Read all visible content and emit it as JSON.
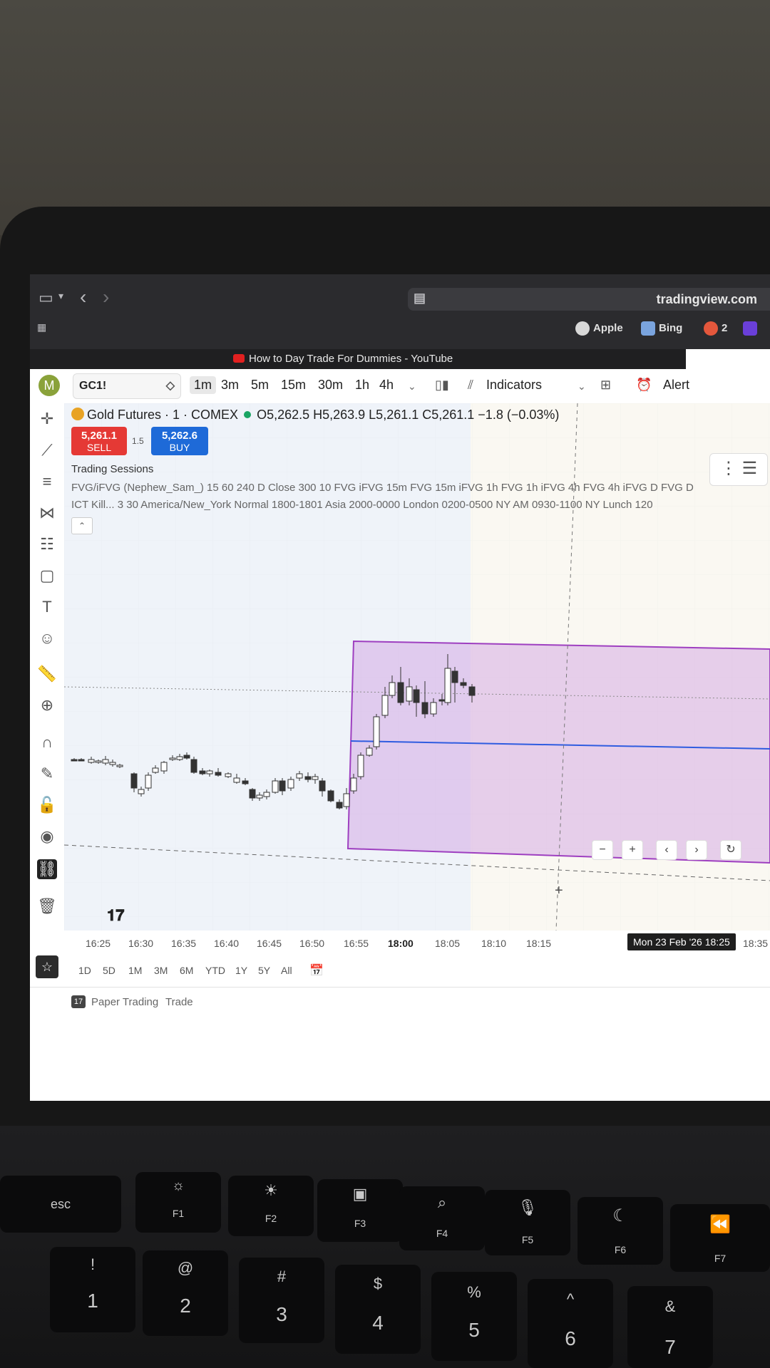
{
  "browser": {
    "url": "tradingview.com",
    "favorites": [
      {
        "label": "Apple",
        "icon": "apple-icon"
      },
      {
        "label": "Bing",
        "icon": "bing-icon"
      },
      {
        "label": "2",
        "icon": "google-icon"
      }
    ],
    "tab_title": "How to Day Trade For Dummies - YouTube"
  },
  "toolbar": {
    "avatar_letter": "M",
    "symbol": "GC1!",
    "timeframes": [
      "1m",
      "3m",
      "5m",
      "15m",
      "30m",
      "1h",
      "4h"
    ],
    "active_timeframe": "1m",
    "indicators_label": "Indicators",
    "alert_label": "Alert"
  },
  "legend": {
    "instrument": "Gold Futures · 1 · COMEX",
    "ohlc": "O5,262.5 H5,263.9 L5,261.1 C5,261.1 −1.8 (−0.03%)",
    "sell_price": "5,261.1",
    "sell_label": "SELL",
    "spread": "1.5",
    "buy_price": "5,262.6",
    "buy_label": "BUY",
    "indicator1": "Trading Sessions",
    "indicator2": "FVG/iFVG (Nephew_Sam_) 15 60 240 D Close 300 10 FVG iFVG 15m FVG 15m iFVG 1h FVG 1h iFVG 4h FVG 4h iFVG D FVG D",
    "indicator3": "ICT Kill... 3 30 America/New_York Normal 1800-1801 Asia 2000-0000 London 0200-0500 NY AM 0930-1100 NY Lunch 120"
  },
  "time_axis": {
    "labels": [
      "16:25",
      "16:30",
      "16:35",
      "16:40",
      "16:45",
      "16:50",
      "16:55",
      "18:00",
      "18:05",
      "18:10",
      "18:15"
    ],
    "bold_label": "18:00",
    "cursor": "Mon 23 Feb '26  18:25",
    "right_label": "18:35"
  },
  "ranges": [
    "1D",
    "5D",
    "1M",
    "3M",
    "6M",
    "YTD",
    "1Y",
    "5Y",
    "All"
  ],
  "bottom": {
    "paper_trading": "Paper Trading",
    "trade": "Trade"
  },
  "colors": {
    "sell": "#e53935",
    "buy": "#1e6ad8",
    "session_box": "#cf9be0",
    "level_line": "#2f5ce0"
  },
  "keyboard": {
    "fn_row": [
      "esc",
      "F1",
      "F2",
      "F3",
      "F4",
      "F5",
      "F6",
      "F7"
    ],
    "num_row": [
      {
        "top": "!",
        "main": "1"
      },
      {
        "top": "@",
        "main": "2"
      },
      {
        "top": "#",
        "main": "3"
      },
      {
        "top": "$",
        "main": "4"
      },
      {
        "top": "%",
        "main": "5"
      },
      {
        "top": "^",
        "main": "6"
      },
      {
        "top": "&",
        "main": "7"
      }
    ]
  }
}
